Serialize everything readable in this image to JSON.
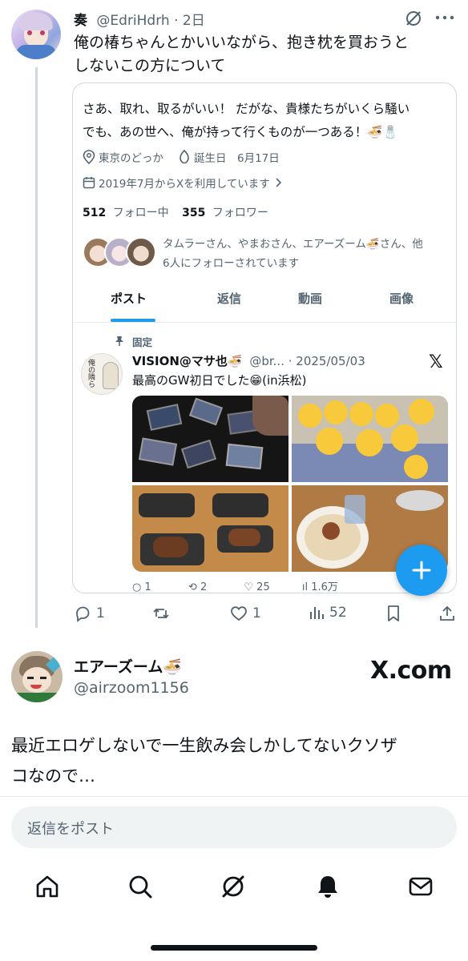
{
  "post": {
    "display_name": "奏",
    "handle": "@EdriHdrh",
    "time": "· 2日",
    "text_line1": "俺の椿ちゃんとかいいながら、抱き枕を買おうと",
    "text_line2": "しないこの方について"
  },
  "profile_card": {
    "bio_line1": "さあ、取れ、取るがいい！ だがな、貴様たちがいくら騒い",
    "bio_line2": "でも、あの世へ、俺が持って行くものが一つある！🍜🧂",
    "location": "東京のどっか",
    "birthday": "誕生日　6月17日",
    "joined": "2019年7月からXを利用しています",
    "following_count": "512",
    "following_label": "フォロー中",
    "followers_count": "355",
    "followers_label": "フォロワー",
    "followed_by_line1": "タムラーさん、やまおさん、エアーズーム🍜さん、他",
    "followed_by_line2": "6人にフォローされています",
    "tabs": [
      "ポスト",
      "返信",
      "動画",
      "画像"
    ],
    "pinned_label": "固定",
    "pinned_name": "VISION@マサ也🍜",
    "pinned_handle": "@br...",
    "pinned_date": "· 2025/05/03",
    "pinned_text": "最高のGW初日でした😁(in浜松)",
    "stats": [
      "1",
      "2",
      "25",
      "1.6万"
    ],
    "avatar_text": "俺の隣ら"
  },
  "actions": {
    "replies": "1",
    "reposts": "",
    "likes": "1",
    "views": "52"
  },
  "reply": {
    "display_name": "エアーズーム🍜",
    "handle": "@airzoom1156",
    "brand": "X.com",
    "text_line1": "最近エロゲしないで一生飲み会しかしてないクソザ",
    "text_line2": "コなので…"
  },
  "compose": {
    "placeholder": "返信をポスト"
  },
  "colors": {
    "accent": "#1d9bf0",
    "text": "#0f1419",
    "muted": "#536471",
    "border": "#cfd9de"
  }
}
